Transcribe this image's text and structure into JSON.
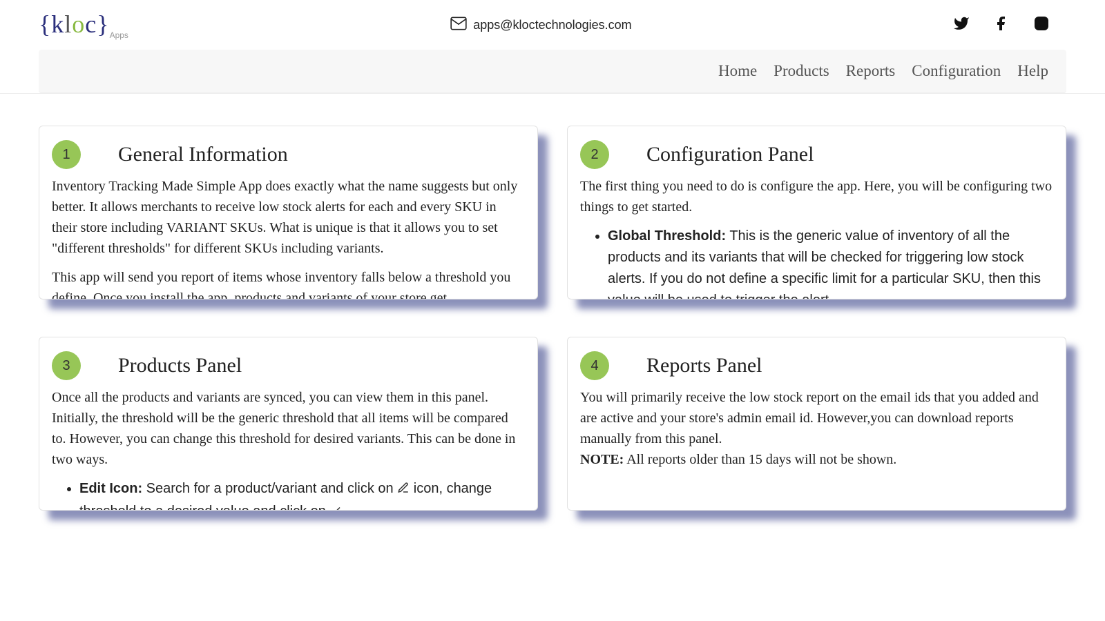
{
  "header": {
    "logo_text": "{kloc}",
    "logo_sub": "Apps",
    "email": "apps@kloctechnologies.com"
  },
  "nav": {
    "items": [
      "Home",
      "Products",
      "Reports",
      "Configuration",
      "Help"
    ]
  },
  "cards": [
    {
      "num": "1",
      "title": "General Information",
      "para1": "Inventory Tracking Made Simple App does exactly what the name suggests but only better. It allows merchants to receive low stock alerts for each and every SKU in their store including VARIANT SKUs. What is unique is that it allows you to set \"different thresholds\" for different SKUs including variants.",
      "para2": "This app will send you report of items whose inventory falls below a threshold you define. Once you install the app, products and variants of your store get"
    },
    {
      "num": "2",
      "title": "Configuration Panel",
      "para1": "The first thing you need to do is configure the app. Here, you will be configuring two things to get started.",
      "bullet_label": "Global Threshold:",
      "bullet_text": " This is the generic value of inventory of all the products and its variants that will be checked for triggering low stock alerts. If you do not define a specific limit for a particular SKU, then this value will be used to trigger the alert."
    },
    {
      "num": "3",
      "title": "Products Panel",
      "para1": "Once all the products and variants are synced, you can view them in this panel. Initially, the threshold will be the generic threshold that all items will be compared to. However, you can change this threshold for desired variants. This can be done in two ways.",
      "bullet_label": "Edit Icon:",
      "bullet_text_a": " Search for a product/variant and click on ",
      "bullet_text_b": " icon, change threshold to a desired value and click on "
    },
    {
      "num": "4",
      "title": "Reports Panel",
      "para1": "You will primarily receive the low stock report on the email ids that you added and are active and your store's admin email id. However,you can download reports manually from this panel.",
      "note_label": "NOTE:",
      "note_text": " All reports older than 15 days will not be shown."
    }
  ]
}
